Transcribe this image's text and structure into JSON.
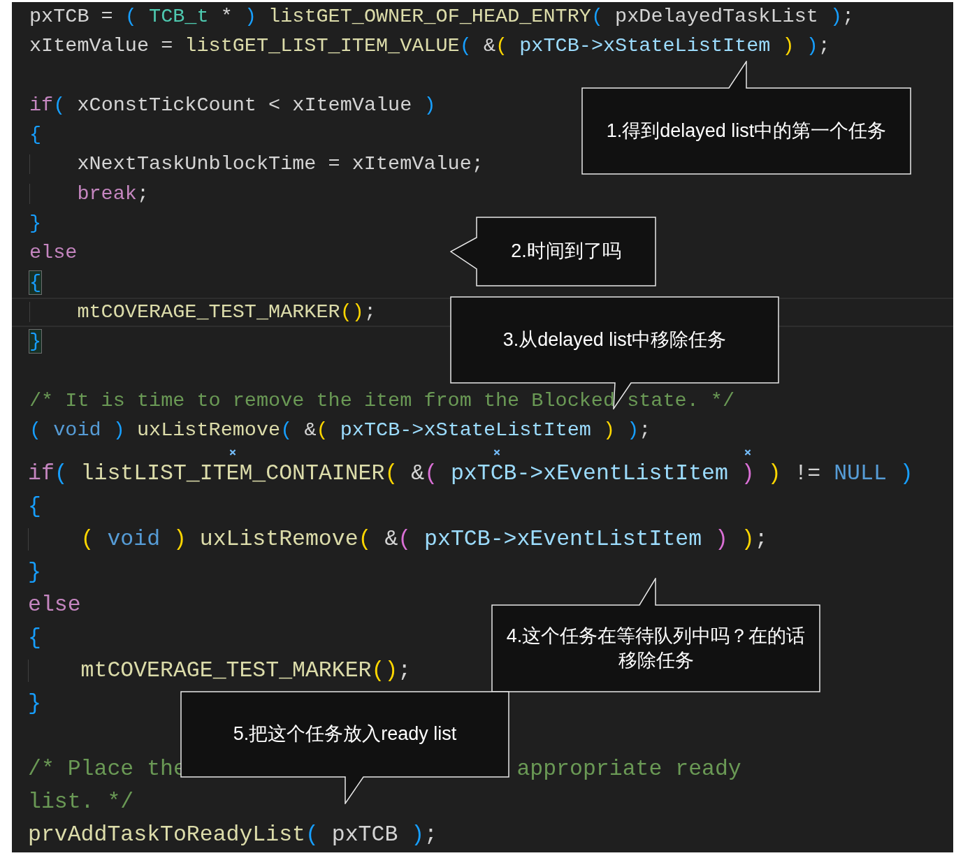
{
  "code": {
    "sections": [
      {
        "lines": [
          {
            "current": false,
            "tokens": [
              {
                "kind": "plain",
                "text": "pxTCB = "
              },
              {
                "kind": "b3",
                "text": "( "
              },
              {
                "kind": "type",
                "text": "TCB_t"
              },
              {
                "kind": "plain",
                "text": " * "
              },
              {
                "kind": "b3",
                "text": ")"
              },
              {
                "kind": "fn",
                "text": " listGET_OWNER_OF_HEAD_ENTRY"
              },
              {
                "kind": "b3",
                "text": "("
              },
              {
                "kind": "plain",
                "text": " pxDelayedTaskList "
              },
              {
                "kind": "b3",
                "text": ")"
              },
              {
                "kind": "plain",
                "text": ";"
              }
            ]
          },
          {
            "current": false,
            "tokens": [
              {
                "kind": "plain",
                "text": "xItemValue = "
              },
              {
                "kind": "fn",
                "text": "listGET_LIST_ITEM_VALUE"
              },
              {
                "kind": "b3",
                "text": "("
              },
              {
                "kind": "plain",
                "text": " &"
              },
              {
                "kind": "b1",
                "text": "("
              },
              {
                "kind": "var",
                "text": " pxTCB->xStateListItem "
              },
              {
                "kind": "b1",
                "text": ")"
              },
              {
                "kind": "b3",
                "text": " )"
              },
              {
                "kind": "plain",
                "text": ";"
              }
            ]
          },
          {
            "current": false
          },
          {
            "current": false,
            "tokens": [
              {
                "kind": "kw",
                "text": "if"
              },
              {
                "kind": "b3",
                "text": "("
              },
              {
                "kind": "plain",
                "text": " xConstTickCount < xItemValue "
              },
              {
                "kind": "b3",
                "text": ")"
              }
            ]
          },
          {
            "current": false,
            "tokens": [
              {
                "kind": "b3",
                "text": "{"
              }
            ]
          },
          {
            "current": false,
            "tokens": [
              {
                "kind": "indent"
              },
              {
                "kind": "plain",
                "text": "xNextTaskUnblockTime = xItemValue;"
              }
            ]
          },
          {
            "current": false,
            "tokens": [
              {
                "kind": "indent"
              },
              {
                "kind": "kw",
                "text": "break"
              },
              {
                "kind": "plain",
                "text": ";"
              }
            ]
          },
          {
            "current": false,
            "tokens": [
              {
                "kind": "b3",
                "text": "}"
              }
            ]
          },
          {
            "current": false,
            "tokens": [
              {
                "kind": "kw",
                "text": "else"
              }
            ]
          },
          {
            "current": false,
            "tokens": [
              {
                "kind": "b3",
                "text": "{",
                "matched": true
              }
            ]
          },
          {
            "current": true,
            "tokens": [
              {
                "kind": "indent"
              },
              {
                "kind": "fn",
                "text": "mtCOVERAGE_TEST_MARKER"
              },
              {
                "kind": "b1",
                "text": "()"
              },
              {
                "kind": "plain",
                "text": ";"
              }
            ]
          },
          {
            "current": false,
            "tokens": [
              {
                "kind": "b3",
                "text": "}",
                "matched": true
              }
            ]
          },
          {
            "current": false
          },
          {
            "current": false,
            "tokens": [
              {
                "kind": "comment",
                "text": "/* It is time to remove the item from the Blocked state. */"
              }
            ]
          },
          {
            "current": false,
            "tokens": [
              {
                "kind": "b3",
                "text": "("
              },
              {
                "kind": "const",
                "text": " void "
              },
              {
                "kind": "b3",
                "text": ")"
              },
              {
                "kind": "fn",
                "text": " uxListRemove"
              },
              {
                "kind": "b3",
                "text": "("
              },
              {
                "kind": "plain",
                "text": " &"
              },
              {
                "kind": "b1",
                "text": "("
              },
              {
                "kind": "var",
                "text": " pxTCB->xStateListItem "
              },
              {
                "kind": "b1",
                "text": ")"
              },
              {
                "kind": "b3",
                "text": " )"
              },
              {
                "kind": "plain",
                "text": ";"
              }
            ]
          }
        ]
      },
      {
        "lines": [
          {
            "current": false,
            "tokens": [
              {
                "kind": "kw",
                "text": "if"
              },
              {
                "kind": "b3",
                "text": "("
              },
              {
                "kind": "fn",
                "text": " listLIST_IT"
              },
              {
                "kind": "fn",
                "text": "EM_CONTAINER",
                "marked": true
              },
              {
                "kind": "b1",
                "text": "("
              },
              {
                "kind": "plain",
                "text": " &"
              },
              {
                "kind": "b2",
                "text": "("
              },
              {
                "kind": "var",
                "text": " pxT"
              },
              {
                "kind": "var",
                "text": "CB->xEventListItem ",
                "marked": true
              },
              {
                "kind": "b2",
                "text": ")",
                "marked": true
              },
              {
                "kind": "b1",
                "text": " )"
              },
              {
                "kind": "plain",
                "text": " != "
              },
              {
                "kind": "const",
                "text": "NULL"
              },
              {
                "kind": "b3",
                "text": " )"
              }
            ]
          },
          {
            "current": false,
            "tokens": [
              {
                "kind": "b3",
                "text": "{"
              }
            ]
          },
          {
            "current": false,
            "tokens": [
              {
                "kind": "indent"
              },
              {
                "kind": "b1",
                "text": "("
              },
              {
                "kind": "const",
                "text": " void "
              },
              {
                "kind": "b1",
                "text": ")"
              },
              {
                "kind": "fn",
                "text": " uxListRemove"
              },
              {
                "kind": "b1",
                "text": "("
              },
              {
                "kind": "plain",
                "text": " &"
              },
              {
                "kind": "b2",
                "text": "("
              },
              {
                "kind": "var",
                "text": " pxTCB->xEventListItem "
              },
              {
                "kind": "b2",
                "text": ")"
              },
              {
                "kind": "b1",
                "text": " )"
              },
              {
                "kind": "plain",
                "text": ";"
              }
            ]
          },
          {
            "current": false,
            "tokens": [
              {
                "kind": "b3",
                "text": "}"
              }
            ]
          },
          {
            "current": false,
            "tokens": [
              {
                "kind": "kw",
                "text": "else"
              }
            ]
          },
          {
            "current": false,
            "tokens": [
              {
                "kind": "b3",
                "text": "{"
              }
            ]
          },
          {
            "current": false,
            "tokens": [
              {
                "kind": "indent"
              },
              {
                "kind": "fn",
                "text": "mtCOVERAGE_TEST_MARKER"
              },
              {
                "kind": "b1",
                "text": "()"
              },
              {
                "kind": "plain",
                "text": ";"
              }
            ]
          },
          {
            "current": false,
            "tokens": [
              {
                "kind": "b3",
                "text": "}"
              }
            ]
          },
          {
            "current": false
          },
          {
            "current": false,
            "tokens": [
              {
                "kind": "comment",
                "text": "/* Place the"
              },
              {
                "kind": "covered"
              },
              {
                "kind": "comment",
                "text": "appropriate ready"
              }
            ]
          },
          {
            "current": false,
            "tokens": [
              {
                "kind": "comment",
                "text": "list. */"
              }
            ]
          },
          {
            "current": false,
            "tokens": [
              {
                "kind": "fn",
                "text": "prvAddTaskToReadyList"
              },
              {
                "kind": "b3",
                "text": "("
              },
              {
                "kind": "plain",
                "text": " pxTCB "
              },
              {
                "kind": "b3",
                "text": ")"
              },
              {
                "kind": "plain",
                "text": ";"
              }
            ]
          }
        ]
      }
    ]
  },
  "callouts": [
    {
      "text": "1.得到delayed list中的第一个任务"
    },
    {
      "text": "2.时间到了吗"
    },
    {
      "text": "3.从delayed list中移除任务"
    },
    {
      "text": "4.这个任务在等待队列中吗？在的话移除任务"
    },
    {
      "text": "5.把这个任务放入ready list"
    }
  ]
}
